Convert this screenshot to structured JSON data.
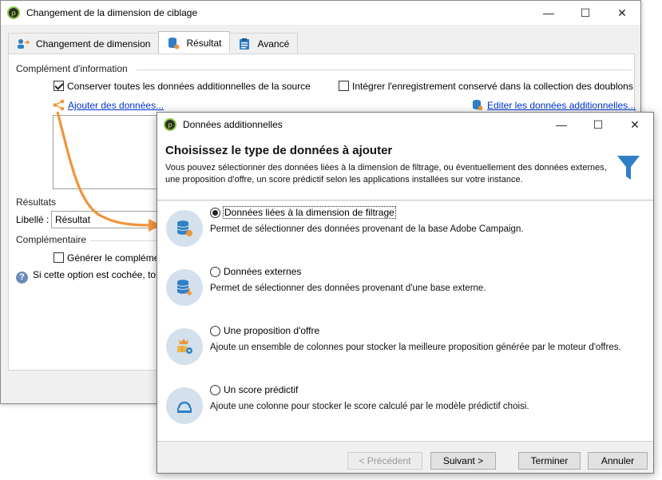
{
  "back_window": {
    "title": "Changement de la dimension de ciblage",
    "controls": {
      "minimize": "—",
      "maximize": "☐",
      "close": "✕"
    },
    "tabs": [
      {
        "label": "Changement de dimension"
      },
      {
        "label": "Résultat"
      },
      {
        "label": "Avancé"
      }
    ],
    "complement_section": "Complément d'information",
    "keep_data_checkbox": "Conserver toutes les données additionnelles de la source",
    "integrate_checkbox": "Intégrer l'enregistrement conservé dans la collection des doublons",
    "add_data_link": "Ajouter des données...",
    "edit_data_link": "Editer les données additionnelles...",
    "results_section": "Résultats",
    "label_field_label": "Libellé :",
    "label_field_value": "Résultat",
    "complementary_section": "Complémentaire",
    "generate_checkbox": "Générer le compléme",
    "info_text": "Si cette option est cochée, tou"
  },
  "dialog": {
    "title": "Données additionnelles",
    "controls": {
      "minimize": "—",
      "maximize": "☐",
      "close": "✕"
    },
    "heading": "Choisissez le type de données à ajouter",
    "description": "Vous pouvez sélectionner des données liées à la dimension de filtrage, ou éventuellement des données externes, une proposition d'offre, un score prédictif selon les applications installées sur votre instance.",
    "options": [
      {
        "title": "Données liées à la dimension de filtrage",
        "description": "Permet de sélectionner des données provenant de la base Adobe Campaign.",
        "selected": true,
        "icon": "database-icon"
      },
      {
        "title": "Données externes",
        "description": "Permet de sélectionner des données provenant d'une base externe.",
        "selected": false,
        "icon": "external-database-icon"
      },
      {
        "title": "Une proposition d'offre",
        "description": "Ajoute un ensemble de colonnes pour stocker la meilleure proposition générée par le moteur d'offres.",
        "selected": false,
        "icon": "offer-icon"
      },
      {
        "title": "Un score prédictif",
        "description": "Ajoute une colonne pour stocker le score calculé par le modèle prédictif choisi.",
        "selected": false,
        "icon": "predictive-score-icon"
      }
    ],
    "buttons": {
      "previous": "< Précédent",
      "next": "Suivant >",
      "finish": "Terminer",
      "cancel": "Annuler"
    }
  },
  "colors": {
    "link": "#0033cc",
    "accent_orange": "#f0943c",
    "icon_blue": "#2f7fc6",
    "icon_circle_bg": "#d4e1ec"
  }
}
